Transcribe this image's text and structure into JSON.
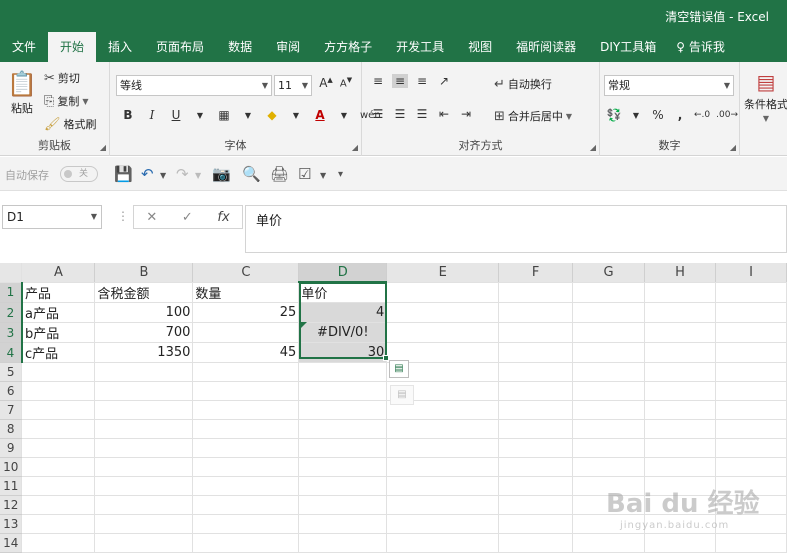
{
  "titlebar": {
    "title": "清空错误值  -  Excel"
  },
  "tabs": [
    {
      "label": "文件"
    },
    {
      "label": "开始"
    },
    {
      "label": "插入"
    },
    {
      "label": "页面布局"
    },
    {
      "label": "数据"
    },
    {
      "label": "审阅"
    },
    {
      "label": "方方格子"
    },
    {
      "label": "开发工具"
    },
    {
      "label": "视图"
    },
    {
      "label": "福昕阅读器"
    },
    {
      "label": "DIY工具箱"
    },
    {
      "label": "告诉我"
    }
  ],
  "ribbon": {
    "clipboard": {
      "paste": "粘贴",
      "cut": "剪切",
      "copy": "复制",
      "format_painter": "格式刷",
      "label": "剪贴板"
    },
    "font": {
      "name": "等线",
      "size": "11",
      "label": "字体",
      "bold": "B",
      "italic": "I",
      "underline": "U",
      "phonetic": "wén"
    },
    "alignment": {
      "wrap": "自动换行",
      "merge": "合并后居中",
      "label": "对齐方式"
    },
    "number": {
      "format": "常规",
      "percent": "%",
      "comma": ",",
      "label": "数字"
    },
    "styles": {
      "conditional": "条件格式"
    }
  },
  "qat": {
    "autosave": "自动保存",
    "toggle": "关"
  },
  "formula_bar": {
    "name_box": "D1",
    "formula": "单价",
    "fx": "fx"
  },
  "sheet": {
    "columns": [
      "A",
      "B",
      "C",
      "D",
      "E",
      "F",
      "G",
      "H",
      "I"
    ],
    "rows": [
      {
        "n": "1",
        "a": "产品",
        "b": "含税金额",
        "c": "数量",
        "d": "单价"
      },
      {
        "n": "2",
        "a": "a产品",
        "b": "100",
        "c": "25",
        "d": "4"
      },
      {
        "n": "3",
        "a": "b产品",
        "b": "700",
        "c": "",
        "d": "#DIV/0!"
      },
      {
        "n": "4",
        "a": "c产品",
        "b": "1350",
        "c": "45",
        "d": "30"
      },
      {
        "n": "5"
      },
      {
        "n": "6"
      },
      {
        "n": "7"
      },
      {
        "n": "8"
      },
      {
        "n": "9"
      },
      {
        "n": "10"
      },
      {
        "n": "11"
      },
      {
        "n": "12"
      },
      {
        "n": "13"
      },
      {
        "n": "14"
      }
    ]
  },
  "watermark": {
    "big": "Bai du 经验",
    "small": "jingyan.baidu.com"
  },
  "colors": {
    "accent": "#217346"
  }
}
